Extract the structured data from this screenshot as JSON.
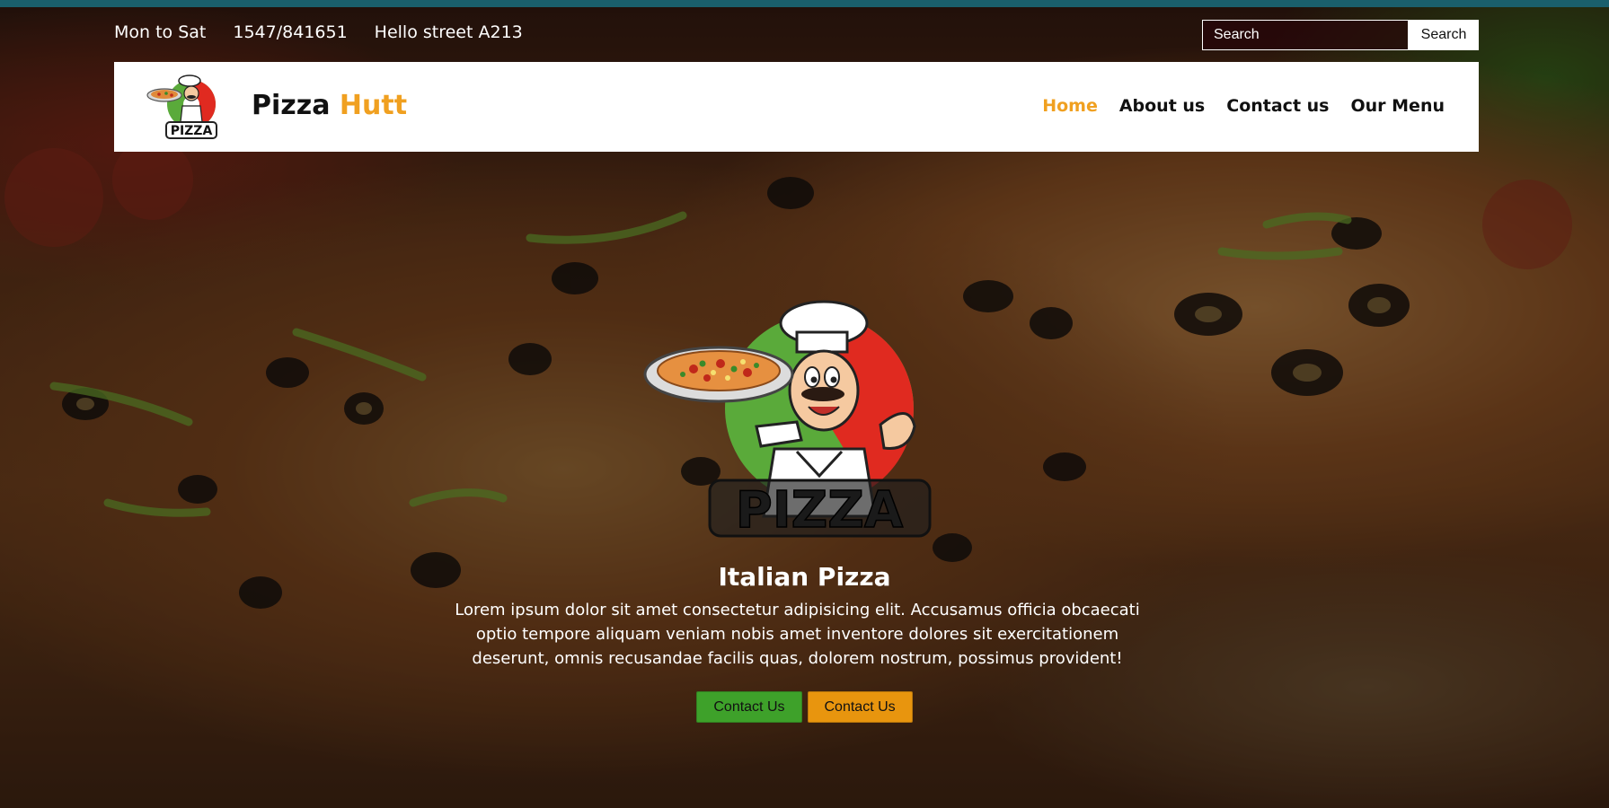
{
  "topbar": {
    "hours": "Mon to Sat",
    "phone": "1547/841651",
    "address": "Hello street A213",
    "search_placeholder": "Search",
    "search_button": "Search"
  },
  "navbar": {
    "brand_main": "Pizza",
    "brand_accent": "Hutt",
    "links": [
      {
        "label": "Home",
        "active": true
      },
      {
        "label": "About us",
        "active": false
      },
      {
        "label": "Contact us",
        "active": false
      },
      {
        "label": "Our Menu",
        "active": false
      }
    ]
  },
  "hero": {
    "logo_word": "PIZZA",
    "title": "Italian Pizza",
    "text": "Lorem ipsum dolor sit amet consectetur adipisicing elit. Accusamus officia obcaecati optio tempore aliquam veniam nobis amet inventore dolores sit exercitationem deserunt, omnis recusandae facilis quas, dolorem nostrum, possimus provident!",
    "button_1": "Contact Us",
    "button_2": "Contact Us"
  },
  "colors": {
    "accent": "#f0a020",
    "top_strip": "#1a5f6c",
    "button_green": "#3ea12a",
    "button_orange": "#e8950e"
  },
  "icons": {
    "nav_logo": "pizza-chef-logo-icon",
    "hero_logo": "pizza-chef-logo-icon"
  }
}
